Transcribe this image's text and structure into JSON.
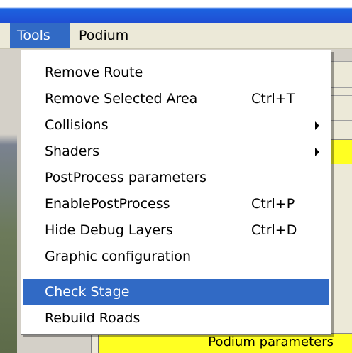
{
  "menubar": {
    "menus": [
      {
        "label": "Tools",
        "active": true
      },
      {
        "label": "Podium",
        "active": false
      }
    ]
  },
  "tools_menu": {
    "items": [
      {
        "label": "Remove Route",
        "shortcut": "",
        "submenu": false,
        "highlighted": false
      },
      {
        "label": "Remove Selected Area",
        "shortcut": "Ctrl+T",
        "submenu": false,
        "highlighted": false
      },
      {
        "label": "Collisions",
        "shortcut": "",
        "submenu": true,
        "highlighted": false
      },
      {
        "label": "Shaders",
        "shortcut": "",
        "submenu": true,
        "highlighted": false
      },
      {
        "label": "PostProcess parameters",
        "shortcut": "",
        "submenu": false,
        "highlighted": false
      },
      {
        "label": "EnablePostProcess",
        "shortcut": "Ctrl+P",
        "submenu": false,
        "highlighted": false
      },
      {
        "label": "Hide Debug Layers",
        "shortcut": "Ctrl+D",
        "submenu": false,
        "highlighted": false
      },
      {
        "label": "Graphic configuration",
        "shortcut": "",
        "submenu": false,
        "highlighted": false
      },
      {
        "label": "Check Stage",
        "shortcut": "",
        "submenu": false,
        "highlighted": true
      },
      {
        "label": "Rebuild Roads",
        "shortcut": "",
        "submenu": false,
        "highlighted": false
      }
    ]
  },
  "background_app": {
    "podium_parameters_label": "Podium parameters"
  },
  "colors": {
    "highlight": "#316ac5",
    "menubar_bg": "#ece9d8",
    "titlebar": "#1f4fd4",
    "panel_yellow": "#ffff22"
  }
}
